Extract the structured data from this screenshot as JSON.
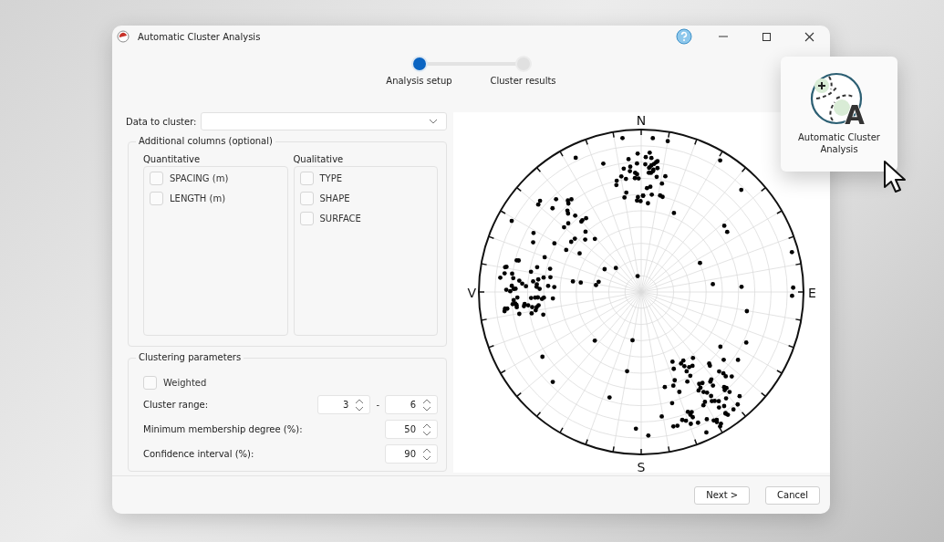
{
  "window": {
    "title": "Automatic Cluster Analysis"
  },
  "steps": [
    {
      "label": "Analysis setup",
      "selected": true
    },
    {
      "label": "Cluster results",
      "selected": false
    }
  ],
  "data_to_cluster": {
    "label": "Data to cluster:"
  },
  "additional_columns": {
    "title": "Additional columns (optional)",
    "groups": [
      {
        "title": "Quantitative",
        "items": [
          {
            "label": "SPACING (m)",
            "checked": false
          },
          {
            "label": "LENGTH (m)",
            "checked": false
          }
        ]
      },
      {
        "title": "Qualitative",
        "items": [
          {
            "label": "TYPE",
            "checked": false
          },
          {
            "label": "SHAPE",
            "checked": false
          },
          {
            "label": "SURFACE",
            "checked": false
          }
        ]
      }
    ]
  },
  "clustering_parameters": {
    "title": "Clustering parameters",
    "weighted": {
      "label": "Weighted",
      "checked": false
    },
    "rows": [
      {
        "label": "Cluster range:",
        "values": [
          "3",
          "6"
        ],
        "separator": "-"
      },
      {
        "label": "Minimum membership degree (%):",
        "values": [
          "50"
        ]
      },
      {
        "label": "Confidence interval (%):",
        "values": [
          "90"
        ]
      }
    ]
  },
  "plot": {
    "directions": [
      {
        "label": "N",
        "kind": "top"
      },
      {
        "label": "E",
        "kind": "right"
      },
      {
        "label": "S",
        "kind": "bottom"
      },
      {
        "label": "V",
        "kind": "left"
      }
    ]
  },
  "buttons": [
    {
      "label": "Next >"
    },
    {
      "label": "Cancel"
    }
  ],
  "popup": {
    "icon_letter": "A",
    "label": "Automatic Cluster Analysis"
  }
}
